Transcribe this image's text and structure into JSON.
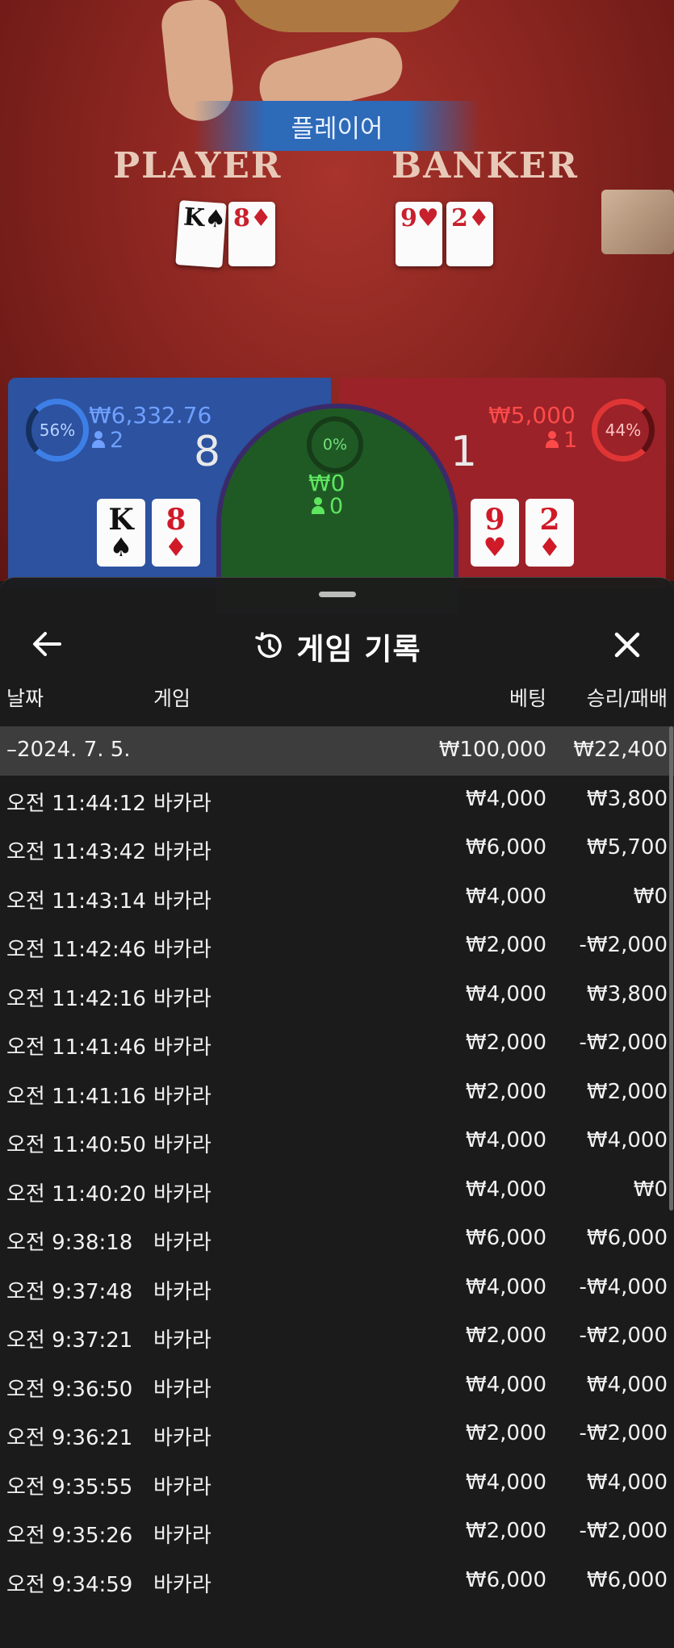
{
  "table": {
    "winner_banner": "플레이어",
    "player_label": "PLAYER",
    "banker_label": "BANKER",
    "player_cards": [
      {
        "rank": "K",
        "suit": "♠",
        "red": false
      },
      {
        "rank": "8",
        "suit": "♦",
        "red": true
      }
    ],
    "banker_cards": [
      {
        "rank": "9",
        "suit": "♥",
        "red": true
      },
      {
        "rank": "2",
        "suit": "♦",
        "red": true
      }
    ]
  },
  "bets": {
    "player": {
      "percent": "56%",
      "amount": "₩6,332.76",
      "count": "2",
      "score": "8"
    },
    "banker": {
      "percent": "44%",
      "amount": "₩5,000",
      "count": "1",
      "score": "1"
    },
    "tie": {
      "percent": "0%",
      "amount": "₩0",
      "count": "0"
    }
  },
  "colors": {
    "player": "#2c52a0",
    "banker": "#9a2228",
    "tie": "#1f5a25"
  },
  "history": {
    "title": "게임 기록",
    "title_icon": "history-clock-icon",
    "back_icon": "arrow-left-icon",
    "close_icon": "close-icon",
    "columns": {
      "date": "날짜",
      "game": "게임",
      "bet": "베팅",
      "result": "승리/패배"
    },
    "summary": {
      "date": "–2024. 7. 5.",
      "bet": "₩100,000",
      "result": "₩22,400"
    },
    "rows": [
      {
        "time": "오전 11:44:12",
        "game": "바카라",
        "bet": "₩4,000",
        "result": "₩3,800"
      },
      {
        "time": "오전 11:43:42",
        "game": "바카라",
        "bet": "₩6,000",
        "result": "₩5,700"
      },
      {
        "time": "오전 11:43:14",
        "game": "바카라",
        "bet": "₩4,000",
        "result": "₩0"
      },
      {
        "time": "오전 11:42:46",
        "game": "바카라",
        "bet": "₩2,000",
        "result": "-₩2,000"
      },
      {
        "time": "오전 11:42:16",
        "game": "바카라",
        "bet": "₩4,000",
        "result": "₩3,800"
      },
      {
        "time": "오전 11:41:46",
        "game": "바카라",
        "bet": "₩2,000",
        "result": "-₩2,000"
      },
      {
        "time": "오전 11:41:16",
        "game": "바카라",
        "bet": "₩2,000",
        "result": "₩2,000"
      },
      {
        "time": "오전 11:40:50",
        "game": "바카라",
        "bet": "₩4,000",
        "result": "₩4,000"
      },
      {
        "time": "오전 11:40:20",
        "game": "바카라",
        "bet": "₩4,000",
        "result": "₩0"
      },
      {
        "time": "오전 9:38:18",
        "game": "바카라",
        "bet": "₩6,000",
        "result": "₩6,000"
      },
      {
        "time": "오전 9:37:48",
        "game": "바카라",
        "bet": "₩4,000",
        "result": "-₩4,000"
      },
      {
        "time": "오전 9:37:21",
        "game": "바카라",
        "bet": "₩2,000",
        "result": "-₩2,000"
      },
      {
        "time": "오전 9:36:50",
        "game": "바카라",
        "bet": "₩4,000",
        "result": "₩4,000"
      },
      {
        "time": "오전 9:36:21",
        "game": "바카라",
        "bet": "₩2,000",
        "result": "-₩2,000"
      },
      {
        "time": "오전 9:35:55",
        "game": "바카라",
        "bet": "₩4,000",
        "result": "₩4,000"
      },
      {
        "time": "오전 9:35:26",
        "game": "바카라",
        "bet": "₩2,000",
        "result": "-₩2,000"
      },
      {
        "time": "오전 9:34:59",
        "game": "바카라",
        "bet": "₩6,000",
        "result": "₩6,000"
      }
    ]
  }
}
